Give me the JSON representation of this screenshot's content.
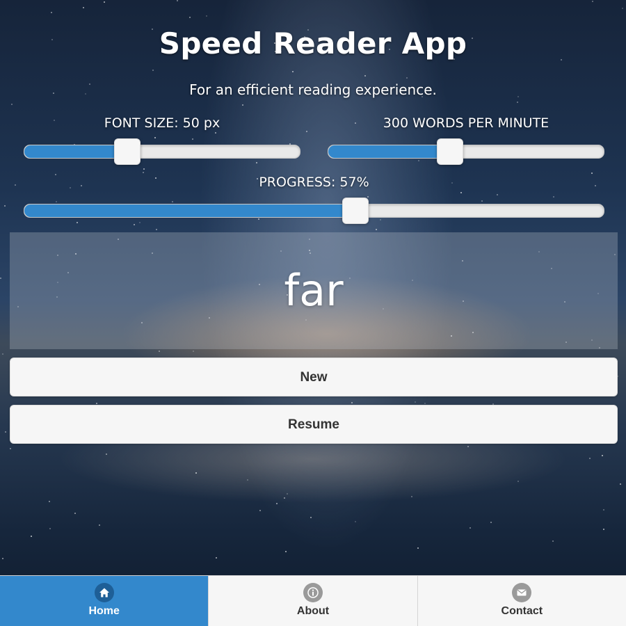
{
  "header": {
    "title": "Speed Reader App",
    "tagline": "For an efficient reading experience."
  },
  "controls": {
    "font_size": {
      "label": "FONT SIZE: 50 px",
      "value": 50,
      "fill_fraction": 0.37
    },
    "speed": {
      "label": "300 WORDS PER MINUTE",
      "value": 300,
      "fill_fraction": 0.44
    },
    "progress": {
      "label": "PROGRESS: 57%",
      "value": 57,
      "fill_fraction": 0.57
    }
  },
  "reader": {
    "current_word": "far"
  },
  "buttons": {
    "new_label": "New",
    "resume_label": "Resume"
  },
  "navbar": {
    "items": [
      {
        "label": "Home",
        "icon": "home-icon",
        "active": true
      },
      {
        "label": "About",
        "icon": "info-icon",
        "active": false
      },
      {
        "label": "Contact",
        "icon": "mail-icon",
        "active": false
      }
    ]
  },
  "colors": {
    "accent": "#3388cc",
    "button_background": "#f6f6f6",
    "button_text": "#333333"
  }
}
